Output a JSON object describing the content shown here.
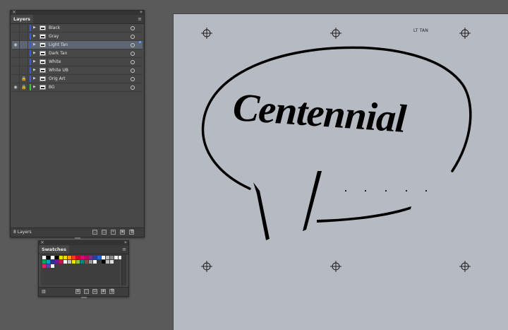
{
  "layers_panel": {
    "tab": "Layers",
    "footer_count": "8 Layers",
    "layers": [
      {
        "name": "Black",
        "visible": false,
        "locked": false,
        "selected": false,
        "color": "#3a5bd8"
      },
      {
        "name": "Gray",
        "visible": false,
        "locked": false,
        "selected": false,
        "color": "#3a5bd8"
      },
      {
        "name": "Light Tan",
        "visible": true,
        "locked": false,
        "selected": true,
        "color": "#3a5bd8"
      },
      {
        "name": "Dark Tan",
        "visible": false,
        "locked": false,
        "selected": false,
        "color": "#3a5bd8"
      },
      {
        "name": "White",
        "visible": false,
        "locked": false,
        "selected": false,
        "color": "#3a5bd8"
      },
      {
        "name": "White UB",
        "visible": false,
        "locked": false,
        "selected": false,
        "color": "#3a5bd8"
      },
      {
        "name": "Orig Art",
        "visible": false,
        "locked": true,
        "selected": false,
        "color": "#3a5bd8"
      },
      {
        "name": "BG",
        "visible": true,
        "locked": true,
        "selected": false,
        "color": "#3cc43c"
      }
    ]
  },
  "swatches_panel": {
    "tab": "Swatches",
    "row1": [
      "#ffffff",
      "#000000",
      "#ffffff",
      "#000000",
      "#e8e000",
      "#ffd800",
      "#ff9a00",
      "#ff3b1e",
      "#d9001a",
      "#e00078",
      "#b8006e",
      "#7f2b8c",
      "#2b3f9c",
      "#0f73c8",
      "#ffffff",
      "#c0c0c0",
      "#8b8b8b",
      "#ffffff",
      "#f4f4f4"
    ],
    "row2": [
      "#00a859",
      "#00a0c6",
      "#2e3192",
      "#6a1b9a",
      "#c2185b",
      "#ffffff",
      "#c0c0c0",
      "#f5e000",
      "#8bc34a",
      "#00897b",
      "#795548",
      "#9e9e9e",
      "#ffffff",
      "#3a3a3a",
      "#000000",
      "#c0c0c0",
      "#e0e0e0"
    ],
    "row3": [
      "#e91e63",
      "#673ab7",
      "#ffffff"
    ]
  },
  "artboard": {
    "label": "LT TAN",
    "artwork_text": "Centennial"
  },
  "icons": {
    "eye": "eye-icon",
    "lock": "lock-icon",
    "target": "target-circle-icon",
    "twirl": "triangle-right-icon"
  }
}
